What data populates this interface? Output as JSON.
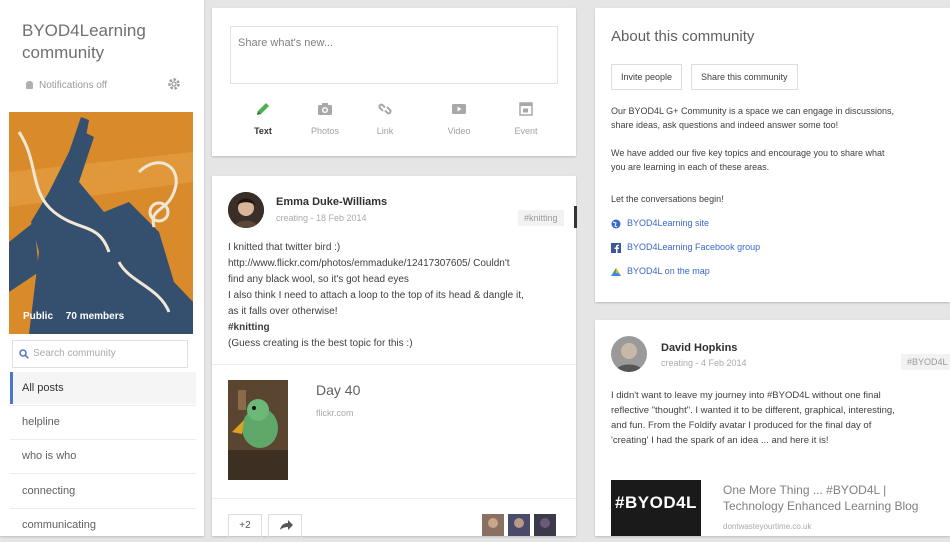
{
  "sidebar": {
    "title": "BYOD4Learning community",
    "notifications": "Notifications off",
    "visibility": "Public",
    "members": "70 members",
    "search_placeholder": "Search community",
    "items": [
      {
        "label": "All posts"
      },
      {
        "label": "helpline"
      },
      {
        "label": "who is who"
      },
      {
        "label": "connecting"
      },
      {
        "label": "communicating"
      }
    ]
  },
  "share": {
    "placeholder": "Share what's new...",
    "tools": [
      {
        "label": "Text",
        "icon": "pencil-icon"
      },
      {
        "label": "Photos",
        "icon": "camera-icon"
      },
      {
        "label": "Link",
        "icon": "link-icon"
      },
      {
        "label": "Video",
        "icon": "video-icon"
      },
      {
        "label": "Event",
        "icon": "calendar-icon"
      }
    ]
  },
  "post1": {
    "author": "Emma Duke-Williams",
    "meta": "creating  -  18 Feb 2014",
    "tag": "#knitting",
    "lines": [
      "I knitted that twitter bird :)",
      "http://www.flickr.com/photos/emmaduke/12417307605/ Couldn't",
      "find any black wool, so it's got head eyes",
      "I also think I need to attach a loop to the top of its head & dangle it,",
      "as it falls over otherwise!",
      "#knitting",
      "(Guess creating is the best topic for this :)"
    ],
    "attachment_title": "Day 40",
    "attachment_sub": "flickr.com",
    "plus_count": "+2"
  },
  "about": {
    "title": "About this community",
    "invite_button": "Invite people",
    "share_button": "Share this community",
    "para1": [
      "Our BYOD4L G+ Community is a space we can engage in discussions,",
      "share ideas, ask questions and indeed answer some too!"
    ],
    "para2": [
      "We have added our five key topics and encourage you to share what",
      "you are learning in each of these areas."
    ],
    "para3": "Let the conversations begin!",
    "links": [
      {
        "label": "BYOD4Learning site",
        "icon": "globe-icon"
      },
      {
        "label": "BYOD4Learning Facebook group",
        "icon": "facebook-icon"
      },
      {
        "label": "BYOD4L on the map",
        "icon": "map-icon"
      }
    ]
  },
  "post2": {
    "author": "David Hopkins",
    "meta": "creating  -  4 Feb 2014",
    "tag": "#BYOD4L",
    "lines": [
      "I didn't want to leave my journey into #BYOD4L without one final",
      "reflective \"thought\". I wanted it to be different, graphical, interesting,",
      "and fun. From the Foldify avatar I produced for the final day of",
      "'creating' I had the spark of an idea ... and here it is!"
    ],
    "card_image_text": "#BYOD4L",
    "card_title_1": "One More Thing ... #BYOD4L |",
    "card_title_2": "Technology Enhanced Learning Blog",
    "card_sub": "dontwasteyourtime.co.uk"
  }
}
